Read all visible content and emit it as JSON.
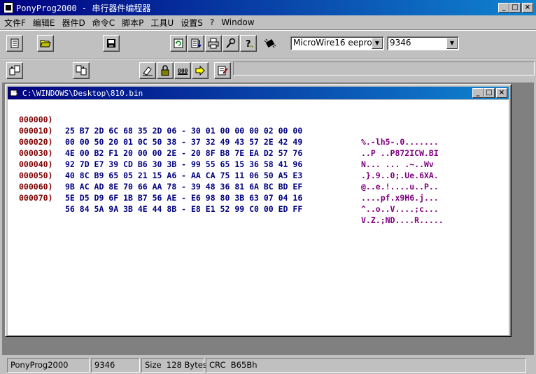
{
  "window": {
    "title": "PonyProg2000 - 串行器件编程器",
    "caption_buttons": [
      "minimize",
      "maximize",
      "close"
    ]
  },
  "menu": [
    "文件F",
    "编辑E",
    "器件D",
    "命令C",
    "脚本P",
    "工具U",
    "设置S",
    "?",
    "Window"
  ],
  "toolbar1": {
    "buttons": [
      "open-device-icon",
      "open-folder-icon",
      "save-icon",
      "reload-icon",
      "edit-buffer-icon",
      "print-icon",
      "setup-icon",
      "help-icon",
      "chip-icon"
    ],
    "device_family": "MicroWire16 eeprom",
    "device_type": "9346"
  },
  "toolbar2": {
    "buttons": [
      "read-device-icon",
      "write-device-icon",
      "erase-icon",
      "lock-icon",
      "verify-icon",
      "program-icon",
      "script-icon"
    ]
  },
  "document": {
    "title": "C:\\WINDOWS\\Desktop\\810.bin",
    "rows": [
      {
        "addr": "000000)",
        "bytes": "25 B7 2D 6C 68 35 2D 06 - 30 01 00 00 00 02 00 00",
        "ascii": "%.-lh5-.0......."
      },
      {
        "addr": "000010)",
        "bytes": "00 00 50 20 01 0C 50 38 - 37 32 49 43 57 2E 42 49",
        "ascii": "..P ..P872ICW.BI"
      },
      {
        "addr": "000020)",
        "bytes": "4E 00 B2 F1 20 00 00 2E - 20 8F B8 7E EA D2 57 76",
        "ascii": "N... ... .~..Wv"
      },
      {
        "addr": "000030)",
        "bytes": "92 7D E7 39 CD B6 30 3B - 99 55 65 15 36 58 41 96",
        "ascii": ".}.9..0;.Ue.6XA."
      },
      {
        "addr": "000040)",
        "bytes": "40 8C B9 65 05 21 15 A6 - AA CA 75 11 06 50 A5 E3",
        "ascii": "@..e.!....u..P.."
      },
      {
        "addr": "000050)",
        "bytes": "9B AC AD 8E 70 66 AA 78 - 39 48 36 81 6A BC BD EF",
        "ascii": "....pf.x9H6.j..."
      },
      {
        "addr": "000060)",
        "bytes": "5E D5 D9 6F 1B B7 56 AE - E6 98 80 3B 63 07 04 16",
        "ascii": "^..o..V....;c..."
      },
      {
        "addr": "000070)",
        "bytes": "56 84 5A 9A 3B 4E 44 8B - E8 E1 52 99 C0 00 ED FF",
        "ascii": "V.Z.;ND....R....."
      }
    ]
  },
  "status": {
    "app": "PonyProg2000",
    "device": "9346",
    "size_label": "Size",
    "size_value": "128 Bytes",
    "crc_label": "CRC",
    "crc_value": "B65Bh"
  }
}
